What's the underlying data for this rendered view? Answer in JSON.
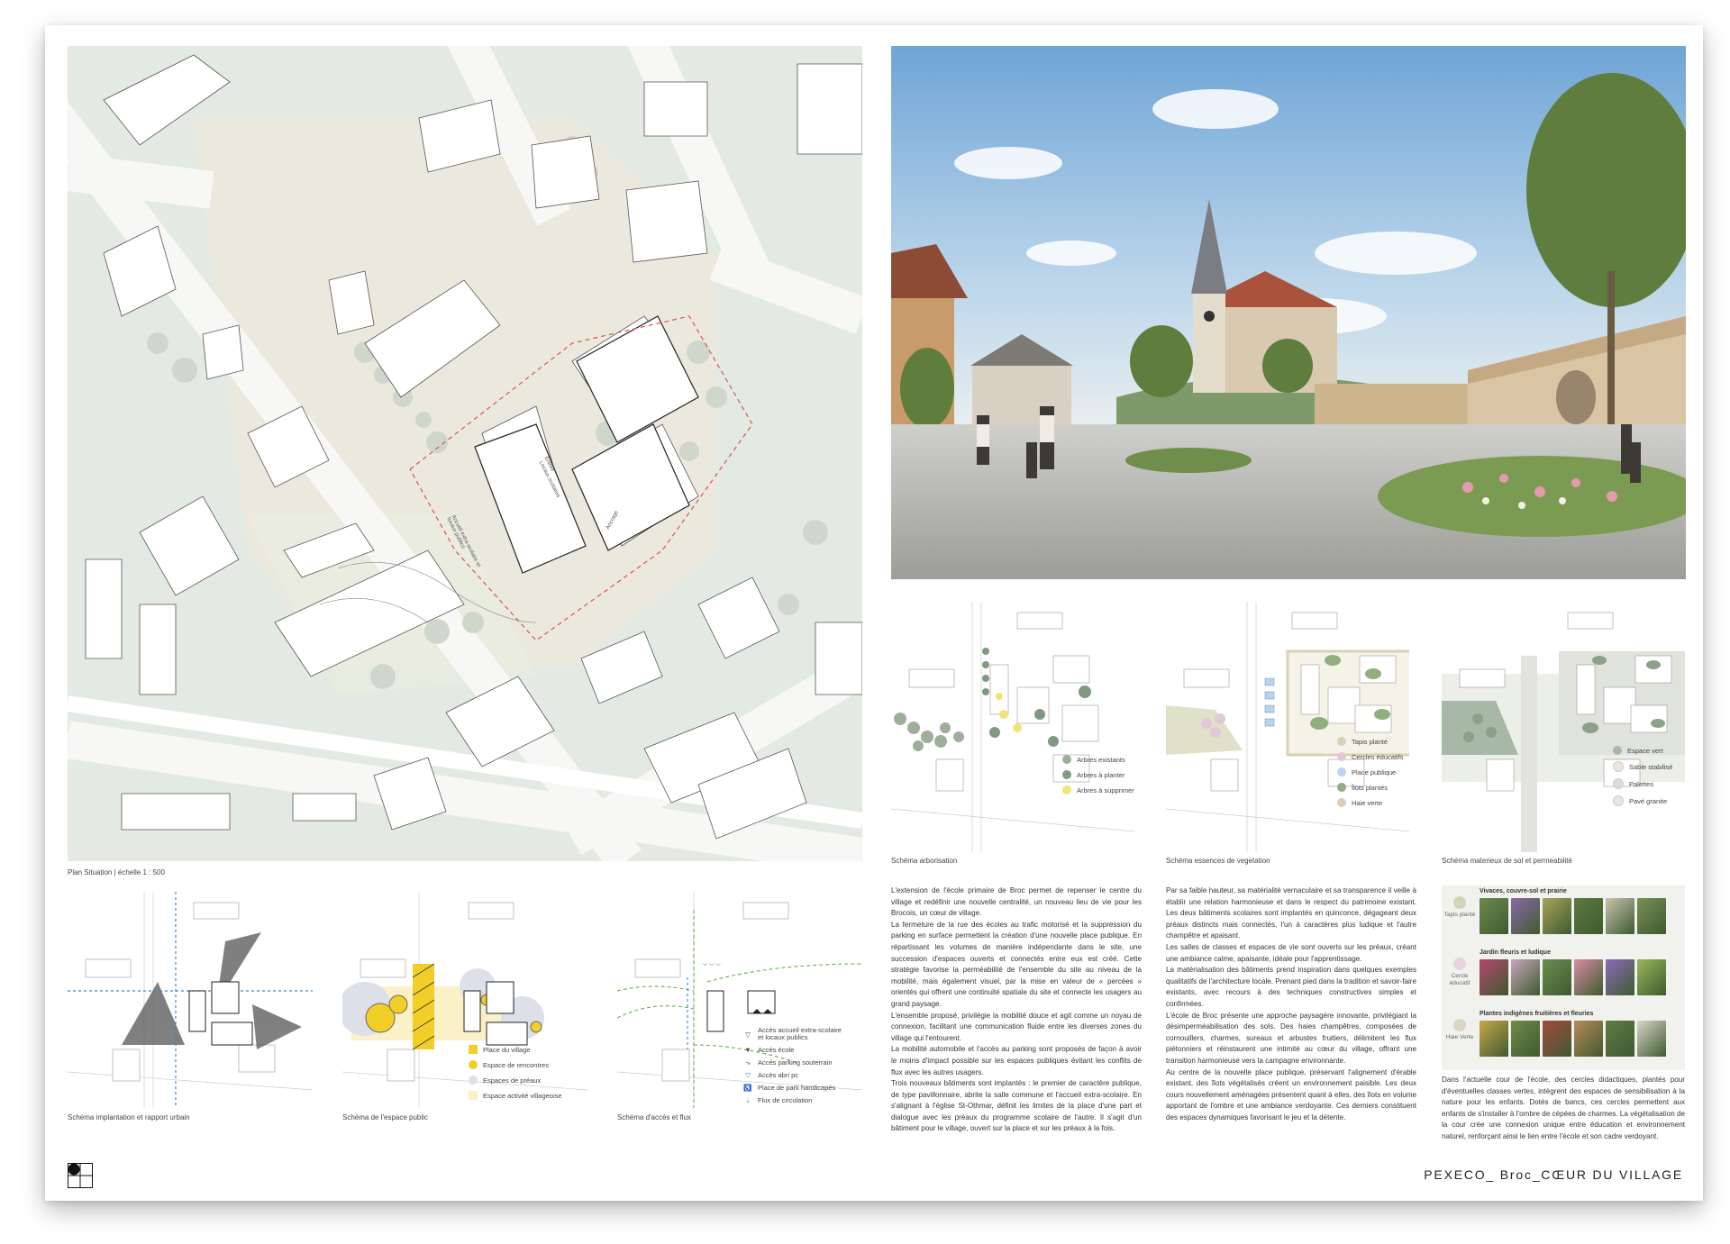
{
  "site_plan": {
    "caption": "Plan Situation | échelle 1 : 500",
    "labels": {
      "entree": "Entrée",
      "locaux": "Locaux scolaires",
      "accueil": "Accueil extra-scolaire et locaux publics",
      "ancrage": "Ancrage"
    }
  },
  "schemas_top": [
    {
      "caption": "Schéma arborisation",
      "legend": [
        {
          "label": "Arbres existants",
          "color": "#9fae9b"
        },
        {
          "label": "Arbres à planter",
          "color": "#7f9a80"
        },
        {
          "label": "Arbres à supprimer",
          "color": "#f3e27a"
        }
      ]
    },
    {
      "caption": "Schéma essences de vegetation",
      "legend": [
        {
          "label": "Tapis planté",
          "color": "#cfd6b8"
        },
        {
          "label": "Cercles éducatifs",
          "color": "#e2c7d8"
        },
        {
          "label": "Place publique",
          "color": "#b9d4ec"
        },
        {
          "label": "Îlots plantés",
          "color": "#8fb07e"
        },
        {
          "label": "Haie verte",
          "color": "#d9d1b4"
        }
      ]
    },
    {
      "caption": "Schéma materieux de sol et permeabilité",
      "legend": [
        {
          "label": "Espace vert",
          "color": "#a7b8a6"
        },
        {
          "label": "Sable stabilisé",
          "color": "#e9e6da"
        },
        {
          "label": "Palettes",
          "color": "#dcdcd6"
        },
        {
          "label": "Pavé granite",
          "color": "#e6e7e3"
        }
      ]
    }
  ],
  "schemas_bottom": [
    {
      "caption": "Schéma implantation et rapport urbain"
    },
    {
      "caption": "Schéma de l'espace public",
      "legend": [
        {
          "label": "Place du village",
          "color": "#f2cf28",
          "shape": "square"
        },
        {
          "label": "Espace de rencontres",
          "color": "#f2cf28",
          "shape": "circle"
        },
        {
          "label": "Espaces de préaux",
          "color": "#dde0e9",
          "shape": "circle"
        },
        {
          "label": "Espace activité villageoise",
          "color": "#faf1c8",
          "shape": "square"
        }
      ]
    },
    {
      "caption": "Schéma d'accès et flux",
      "legend": [
        {
          "label": "Accès accueil extra-scolaire et locaux publics",
          "symbol": "▽"
        },
        {
          "label": "Accès école",
          "symbol": "▼"
        },
        {
          "label": "Accès parking souterrain",
          "symbol": "⬎"
        },
        {
          "label": "Accès abri pc",
          "symbol": "▽"
        },
        {
          "label": "Place de park handicapés",
          "symbol": "♿"
        },
        {
          "label": "Flux de circulation",
          "symbol": "⇣"
        }
      ]
    }
  ],
  "text_col1": [
    "L'extension de l'école primaire de Broc permet de repenser le centre du village et redéfinir une nouvelle centralité, un nouveau lieu de vie pour les Brocois, un cœur de village.",
    "La fermeture de la rue des écoles au trafic motorisé et la suppression du parking en surface permettent la création d'une nouvelle place publique. En répartissant les volumes de manière indépendante dans le site, une succession d'espaces ouverts et connectés entre eux est créé. Cette stratégie favorise la perméabilité de l'ensemble du site au niveau de la mobilité, mais également visuel, par la mise en valeur de « percées » orientés qui offrent une continuité spatiale du site et connecte les usagers au grand paysage.",
    "L'ensemble proposé, privilégie la mobilité douce et agit comme un noyau de connexion, facilitant une communication fluide entre les diverses zones du village qui l'entourent.",
    "La mobilité automobile et l'accès au parking sont proposés de façon à avoir le moins d'impact possible sur les espaces publiques évitant les conflits de flux avec les autres usagers.",
    "Trois nouveaux bâtiments sont implantés : le premier de caractère publique, de type pavillonnaire, abrite la salle commune et l'accueil extra-scolaire. En s'alignant à l'église St-Othmar, définit les limites de la place d'une part et dialogue avec les préaux du programme scolaire de l'autre. Il s'agit d'un bâtiment pour le village, ouvert sur la place et sur les préaux à la fois."
  ],
  "text_col2": [
    "Par sa faible hauteur, sa matérialité vernaculaire et sa transparence il veille à établir une relation harmonieuse et dans le respect du patrimoine existant. Les deux bâtiments scolaires sont implantés en quinconce, dégageant deux préaux distincts mais connectés, l'un à caractères plus ludique et l'autre champêtre et apaisant.",
    "Les salles de classes et espaces de vie sont ouverts sur les préaux, créant une ambiance calme, apaisante, idéale pour l'apprentissage.",
    "La matérialisation des bâtiments prend inspiration dans quelques exemples qualitatifs de l'architecture locale. Prenant pied dans la tradition et savoir-faire existants, avec recours à des techniques constructives simples et confirmées.",
    "L'école de Broc présente une approche paysagère innovante, privilégiant la désimperméabilisation des sols. Des haies champêtres, composées de cornouillers, charmes, sureaux et arbustes fruitiers, délimitent les flux piétonniers et réinstaurent une intimité au cœur du village, offrant une transition harmonieuse vers la campagne environnante.",
    "Au centre de la nouvelle place publique, préservant l'alignement d'érable existant, des îlots végétalisés créent un environnement paisible. Les deux cours nouvellement aménagées présentent quant à elles, des îlots en volume apportant de l'ombre et une ambiance verdoyante. Ces derniers constituent des espaces dynamiques favorisant le jeu et la détente."
  ],
  "plants": {
    "rows": [
      {
        "side_label": "Tapis planté",
        "title": "Vivaces, couvre-sol et prairie",
        "swatch": "#cfd6b8",
        "tiles": [
          "#6d8a4e",
          "#8a6aa8",
          "#a7a35a",
          "#5c7a3f",
          "#c9c3b3",
          "#7a8f55"
        ]
      },
      {
        "side_label": "Cercle éducatif",
        "title": "Jardin fleuris et ludique",
        "swatch": "#e6d4de",
        "tiles": [
          "#b5476e",
          "#c7a6bd",
          "#6a8d4f",
          "#d88fa4",
          "#8c6bb5",
          "#9ab65a"
        ]
      },
      {
        "side_label": "Haie Verte",
        "title": "Plantes indigènes fruitières et fleuries",
        "swatch": "#dcd7c5",
        "tiles": [
          "#c8a84a",
          "#6f8b48",
          "#a34a3f",
          "#b98a5a",
          "#5f7c44",
          "#d8d6c9"
        ]
      }
    ]
  },
  "text_col3": "Dans l'actuelle cour de l'école, des cercles didactiques, plantés pour d'éventuelles classes vertes, intègrent des espaces de sensibilisation à la nature pour les enfants. Dotés de bancs, ces cercles permettent aux enfants de s'installer à l'ombre de cépées de charmes. La végétalisation de la cour crée une connexion unique entre éducation et environnement naturel, renforçant ainsi le lien entre l'école et son cadre verdoyant.",
  "footer_title": "PEXECO_ Broc_CŒUR DU VILLAGE"
}
